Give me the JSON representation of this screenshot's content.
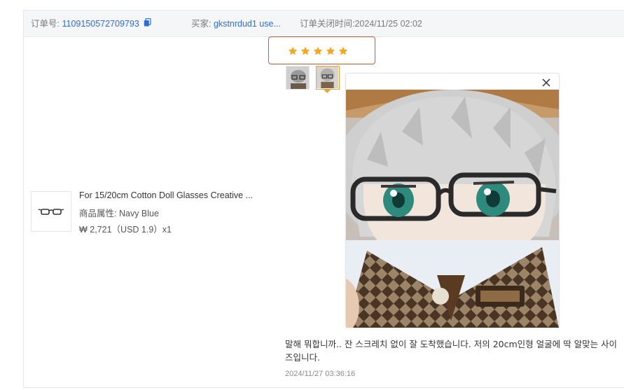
{
  "order": {
    "order_no_label": "订单号:",
    "order_no": "1109150572709793",
    "buyer_label": "买家:",
    "buyer": "gkstnrdud1 use...",
    "closed_label": "订单关闭时间:",
    "closed_time": "2024/11/25 02:02"
  },
  "review": {
    "rating": 5,
    "text": "말해 뭐합니까.. 잔 스크레치 없이 잘 도착했습니다. 저의 20cm인형 얼굴에 딱 알맞는 사이즈입니다.",
    "time": "2024/11/27 03:36:16"
  },
  "product": {
    "title": "For 15/20cm Cotton Doll Glasses Creative ...",
    "attr_label": "商品属性:",
    "attr_value": "Navy Blue",
    "price_text": "₩ 2,721（USD  1.9）x1"
  },
  "colors": {
    "link": "#2f6bdb",
    "star": "#f5a623",
    "highlight_box": "#c9582f",
    "active_thumb": "#f0a030"
  },
  "icons": {
    "copy": "copy-icon",
    "close": "close-icon",
    "star": "star-icon"
  }
}
